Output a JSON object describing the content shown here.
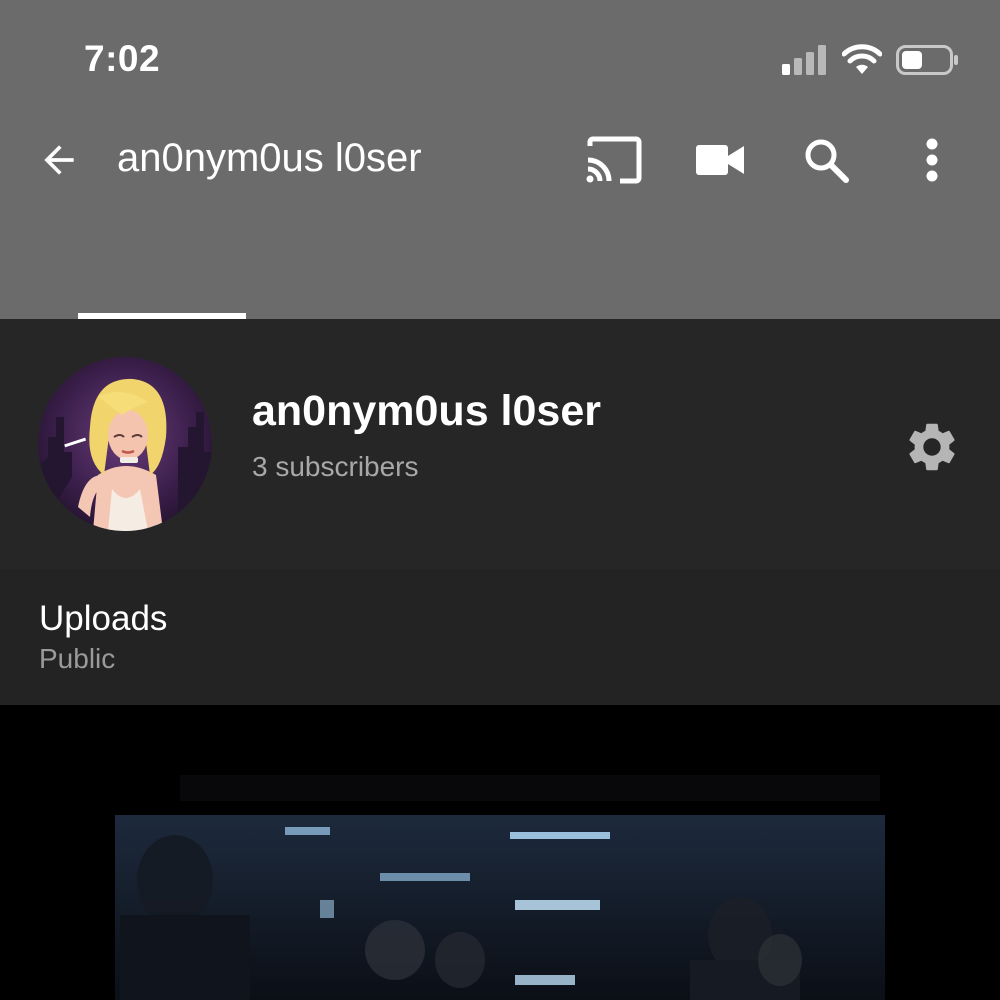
{
  "status_bar": {
    "time": "7:02",
    "icons": [
      "cellular-signal-icon",
      "wifi-icon",
      "battery-icon"
    ]
  },
  "app_bar": {
    "title": "an0nym0us l0ser",
    "back_icon": "arrow-back-icon",
    "actions": [
      "cast-icon",
      "video-camera-icon",
      "search-icon",
      "more-vert-icon"
    ]
  },
  "channel": {
    "name": "an0nym0us l0ser",
    "subscribers": "3 subscribers",
    "settings_icon": "gear-icon"
  },
  "uploads": {
    "title": "Uploads",
    "visibility": "Public"
  },
  "colors": {
    "header_bg": "#6b6b6b",
    "channel_bg": "#262626",
    "uploads_bg": "#232323",
    "text_primary": "#ffffff",
    "text_secondary": "#a8a8a8"
  }
}
